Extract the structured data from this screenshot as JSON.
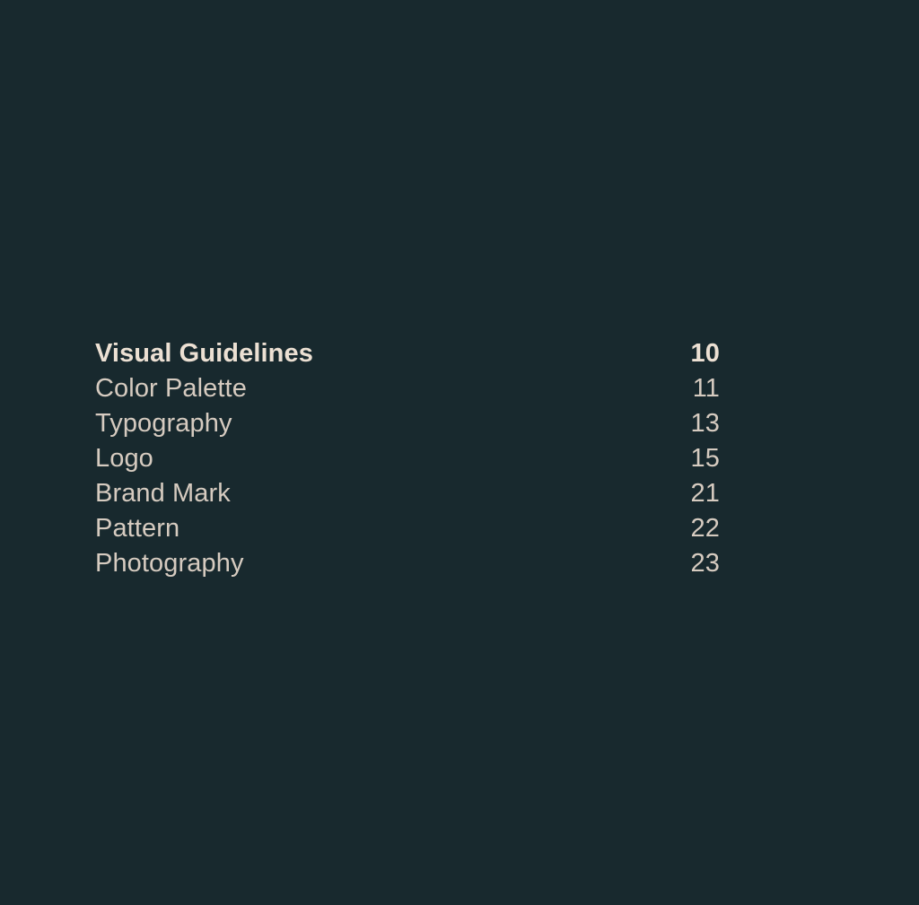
{
  "theme": {
    "background": "#18292e",
    "section_text": "#ece0d3",
    "entry_text": "#d6cbc0"
  },
  "toc": {
    "rows": [
      {
        "label": "Visual Guidelines",
        "page": "10",
        "kind": "section"
      },
      {
        "label": "Color Palette",
        "page": "11",
        "kind": "entry"
      },
      {
        "label": "Typography",
        "page": "13",
        "kind": "entry"
      },
      {
        "label": "Logo",
        "page": "15",
        "kind": "entry"
      },
      {
        "label": "Brand Mark",
        "page": "21",
        "kind": "entry"
      },
      {
        "label": "Pattern",
        "page": "22",
        "kind": "entry"
      },
      {
        "label": "Photography",
        "page": "23",
        "kind": "entry"
      }
    ]
  }
}
